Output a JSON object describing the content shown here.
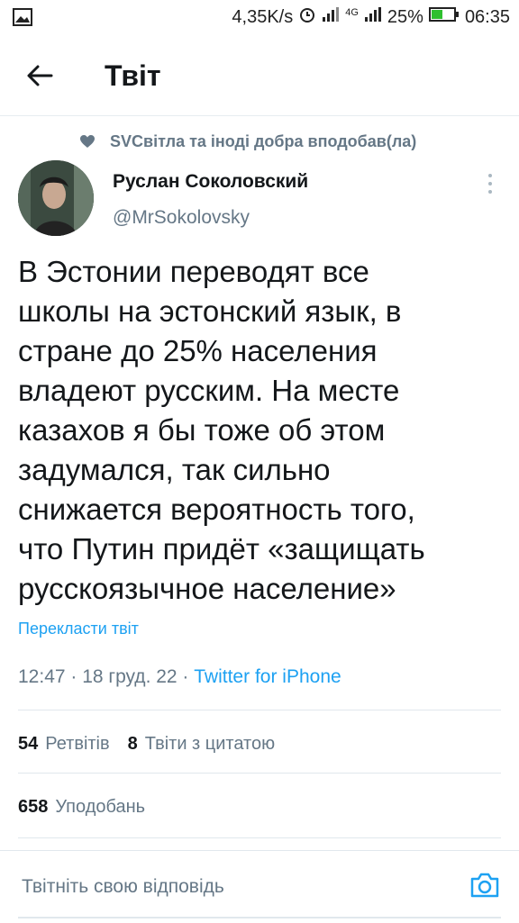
{
  "status_bar": {
    "speed": "4,35K/s",
    "network": "4G",
    "battery": "25%",
    "time": "06:35"
  },
  "header": {
    "title": "Твіт"
  },
  "social_context": {
    "text": "SVСвітла та іноді добра вподобав(ла)"
  },
  "tweet": {
    "author_name": "Руслан Соколовский",
    "author_handle": "@MrSokolovsky",
    "text": "В Эстонии переводят все\nшколы на эстонский язык, в\nстране до 25% населения\nвладеют русским. На месте\nказахов я бы тоже об этом\nзадумался, так сильно\nснижается вероятность того,\nчто Путин придёт «защищать\nрусскоязычное население»",
    "translate_label": "Перекласти твіт",
    "timestamp": "12:47 · 18 груд. 22 · ",
    "source": "Twitter for iPhone"
  },
  "stats": {
    "retweets_count": "54",
    "retweets_label": "Ретвітів",
    "quotes_count": "8",
    "quotes_label": "Твіти з цитатою",
    "likes_count": "658",
    "likes_label": "Уподобань"
  },
  "reply": {
    "placeholder": "Твітніть свою відповідь"
  },
  "colors": {
    "accent": "#1da1f2",
    "secondary_text": "#657786",
    "divider": "#e1e8ed"
  }
}
